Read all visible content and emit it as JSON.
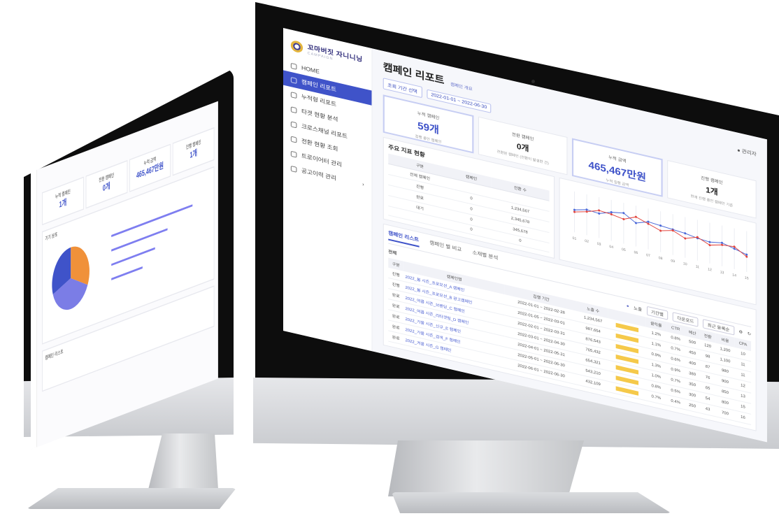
{
  "big": {
    "brand": {
      "name": "꼬마버짓 자니니닝",
      "sub": "CAMPAIGN"
    },
    "nav": [
      {
        "label": "HOME",
        "active": false,
        "icon": "home-icon"
      },
      {
        "label": "캠페인 리포트",
        "active": true,
        "icon": "report-icon"
      },
      {
        "label": "누적형 리포트",
        "active": false,
        "icon": "cumulative-icon"
      },
      {
        "label": "타겟 현황 분석",
        "active": false,
        "icon": "target-icon"
      },
      {
        "label": "크로스채널 리포트",
        "active": false,
        "icon": "cross-channel-icon"
      },
      {
        "label": "전환 현황 조회",
        "active": false,
        "icon": "conversion-icon"
      },
      {
        "label": "트로이어터 관리",
        "active": false,
        "icon": "tracker-icon"
      },
      {
        "label": "공고이력 관리",
        "active": false,
        "icon": "history-icon",
        "chevron": "›"
      }
    ],
    "page_title": "캠페인 리포트",
    "title_sub": "캠페인 개요",
    "user": "관리자",
    "filters": {
      "period_label": "조회 기간 선택",
      "date_range": "2022-01-01 ~ 2022-06-30"
    },
    "kpis": [
      {
        "label": "누적 캠페인",
        "value": "59개",
        "sub": "집행 중인 캠페인"
      },
      {
        "label": "전환 캠페인",
        "value": "0개",
        "sub": "전환된 캠페인 (전환이 발생한 건)"
      },
      {
        "label": "누적 금액",
        "value": "465,467만원",
        "sub": "누적 집행 금액"
      },
      {
        "label": "진행 캠페인",
        "value": "1개",
        "sub": "현재 진행 중인 캠페인 기준"
      }
    ],
    "summary": {
      "title": "주요 지표 현황",
      "columns": [
        "구분",
        "캠페인",
        "전환 수"
      ],
      "rows": [
        [
          "전체 캠페인",
          "",
          ""
        ],
        [
          "진행",
          "0",
          "1,234,567"
        ],
        [
          "완료",
          "0",
          "2,345,678"
        ],
        [
          "대기",
          "0",
          "345,678"
        ],
        [
          "",
          "0",
          "0"
        ]
      ]
    },
    "tabs": [
      "캠페인 리스트",
      "캠페인 별 비교",
      "소재별 분석"
    ],
    "list_toolbar": {
      "count": "전체",
      "legend": "노출",
      "period": "기간별",
      "down": "다운로드",
      "sort": "최근 등록순"
    },
    "list": {
      "columns": [
        "구분",
        "캠페인명",
        "집행 기간",
        "노출 수",
        "클릭률",
        "CTR",
        "예산",
        "전환",
        "비용",
        "CPA"
      ],
      "rows": [
        [
          "진행",
          "2022_봄 시즌_프로모션_A 캠페인",
          "2022-01-01 ~ 2022-02-28",
          "1,234,567",
          "1.2%",
          "0.8%",
          "500",
          "120",
          "1,200",
          "10"
        ],
        [
          "진행",
          "2022_봄 시즌_프로모션_B 광고캠페인",
          "2022-01-05 ~ 2022-03-01",
          "987,654",
          "1.1%",
          "0.7%",
          "450",
          "98",
          "1,100",
          "11"
        ],
        [
          "완료",
          "2022_여름 시즌_브랜딩_C 캠페인",
          "2022-02-01 ~ 2022-03-31",
          "876,543",
          "0.9%",
          "0.6%",
          "400",
          "87",
          "980",
          "11"
        ],
        [
          "완료",
          "2022_여름 시즌_리타겟팅_D 캠페인",
          "2022-03-01 ~ 2022-04-30",
          "765,432",
          "1.3%",
          "0.9%",
          "380",
          "76",
          "900",
          "12"
        ],
        [
          "완료",
          "2022_가을 시즌_신규_E 캠페인",
          "2022-04-01 ~ 2022-05-31",
          "654,321",
          "1.0%",
          "0.7%",
          "350",
          "65",
          "850",
          "13"
        ],
        [
          "완료",
          "2022_가을 시즌_검색_F 캠페인",
          "2022-05-01 ~ 2022-06-30",
          "543,210",
          "0.8%",
          "0.5%",
          "300",
          "54",
          "800",
          "15"
        ],
        [
          "완료",
          "2022_겨울 시즌_G 캠페인",
          "2022-06-01 ~ 2022-06-30",
          "432,109",
          "0.7%",
          "0.4%",
          "250",
          "43",
          "700",
          "16"
        ]
      ]
    },
    "chart_data": {
      "type": "line",
      "x": [
        "01",
        "02",
        "03",
        "04",
        "05",
        "06",
        "07",
        "08",
        "09",
        "10",
        "11",
        "12",
        "13",
        "14",
        "15"
      ],
      "series": [
        {
          "values": [
            42,
            45,
            44,
            48,
            50,
            43,
            47,
            46,
            45,
            44,
            42,
            41,
            43,
            40,
            37
          ]
        },
        {
          "values": [
            40,
            43,
            47,
            46,
            44,
            49,
            45,
            41,
            44,
            39,
            43,
            38,
            41,
            42,
            35
          ]
        }
      ],
      "colors": [
        "#4a68d8",
        "#e2463f"
      ],
      "ylim": [
        20,
        60
      ]
    }
  },
  "small": {
    "kpis": [
      {
        "label": "누적 캠페인",
        "value": "1개"
      },
      {
        "label": "전환 캠페인",
        "value": "0개"
      },
      {
        "label": "누적 금액",
        "value": "465,467만원"
      },
      {
        "label": "진행 캠페인",
        "value": "1개"
      }
    ],
    "pie_title": "기기 분포",
    "pie": [
      0.32,
      0.38,
      0.3
    ],
    "pie_colors": [
      "#f0913a",
      "#7b7de6",
      "#3f53c9"
    ],
    "table_title": "캠페인 리스트"
  }
}
